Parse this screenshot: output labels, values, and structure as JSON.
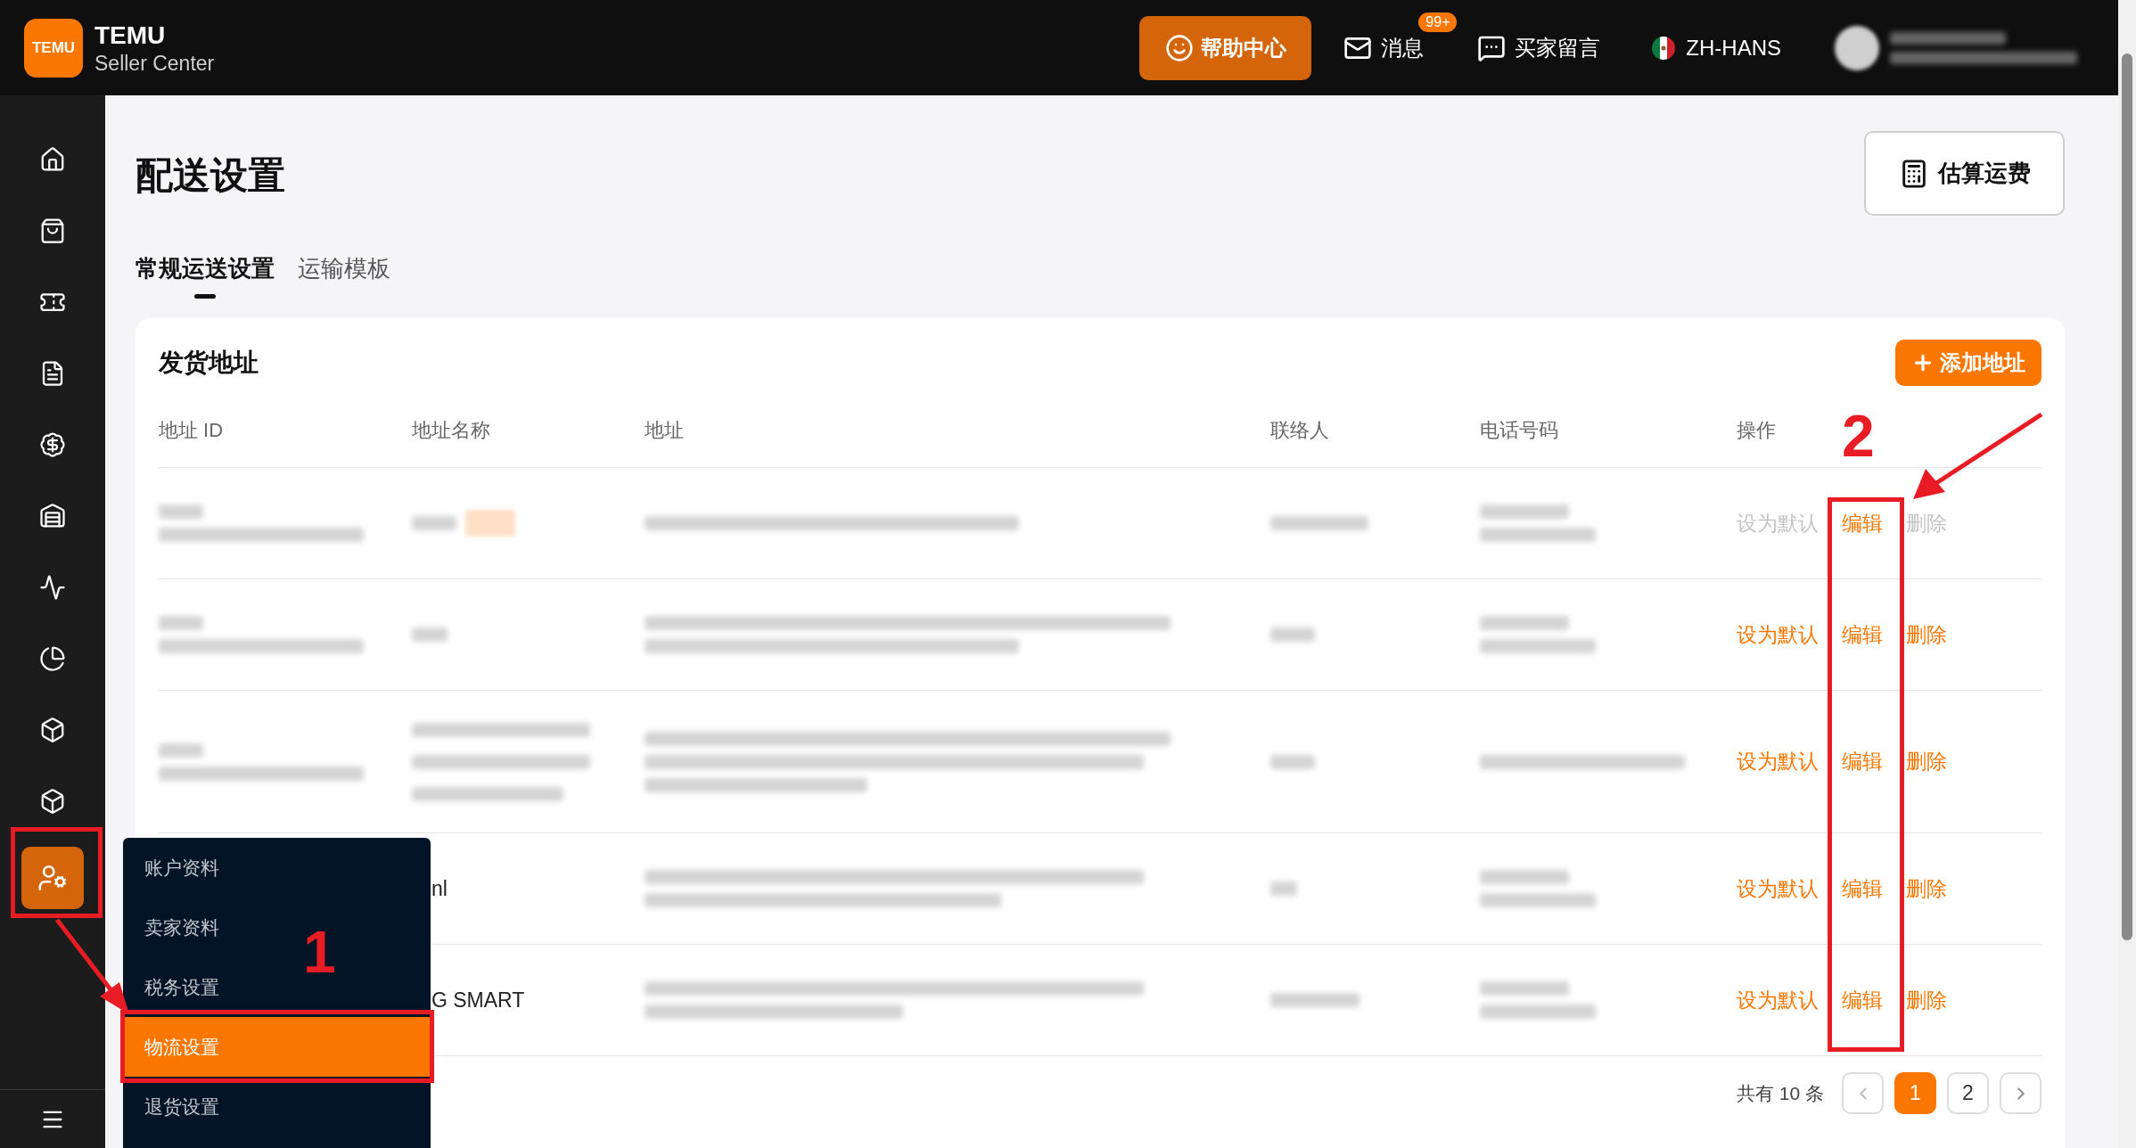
{
  "header": {
    "logo_mark": "TEMU",
    "brand": "TEMU",
    "subtitle": "Seller Center",
    "help_button": "帮助中心",
    "messages": {
      "label": "消息",
      "badge": "99+"
    },
    "buyer_messages": "买家留言",
    "language": "ZH-HANS"
  },
  "sidebar": {
    "items": [
      {
        "selected": false
      },
      {
        "selected": false
      },
      {
        "selected": false
      },
      {
        "selected": false
      },
      {
        "selected": false
      },
      {
        "selected": false
      },
      {
        "selected": false
      },
      {
        "selected": false
      },
      {
        "selected": false
      },
      {
        "selected": false
      },
      {
        "selected": true
      }
    ]
  },
  "menu": {
    "items": [
      {
        "label": "账户资料",
        "selected": false
      },
      {
        "label": "卖家资料",
        "selected": false
      },
      {
        "label": "税务设置",
        "selected": false
      },
      {
        "label": "物流设置",
        "selected": true
      },
      {
        "label": "退货设置",
        "selected": false
      }
    ]
  },
  "page": {
    "title": "配送设置",
    "estimate_button": "估算运费",
    "tabs": [
      {
        "label": "常规运送设置",
        "selected": true
      },
      {
        "label": "运输模板",
        "selected": false
      }
    ]
  },
  "card": {
    "title": "发货地址",
    "add_button": "添加地址",
    "columns": [
      "地址 ID",
      "地址名称",
      "地址",
      "联络人",
      "电话号码",
      "操作"
    ],
    "rows": [
      {
        "name_fragment": "",
        "actions": [
          {
            "label": "设为默认",
            "disabled": true
          },
          {
            "label": "编辑",
            "disabled": false
          },
          {
            "label": "删除",
            "disabled": true
          }
        ]
      },
      {
        "name_fragment": "",
        "actions": [
          {
            "label": "设为默认",
            "disabled": false
          },
          {
            "label": "编辑",
            "disabled": false
          },
          {
            "label": "删除",
            "disabled": false
          }
        ]
      },
      {
        "name_fragment": "",
        "actions": [
          {
            "label": "设为默认",
            "disabled": false
          },
          {
            "label": "编辑",
            "disabled": false
          },
          {
            "label": "删除",
            "disabled": false
          }
        ]
      },
      {
        "name_fragment": "nl",
        "actions": [
          {
            "label": "设为默认",
            "disabled": false
          },
          {
            "label": "编辑",
            "disabled": false
          },
          {
            "label": "删除",
            "disabled": false
          }
        ]
      },
      {
        "name_fragment": "G SMART",
        "actions": [
          {
            "label": "设为默认",
            "disabled": false
          },
          {
            "label": "编辑",
            "disabled": false
          },
          {
            "label": "删除",
            "disabled": false
          }
        ]
      }
    ],
    "pagination": {
      "total": "共有 10 条",
      "pages": [
        {
          "label": "1",
          "selected": true
        },
        {
          "label": "2",
          "selected": false
        }
      ]
    }
  },
  "annotations": {
    "step_1": "1",
    "step_2": "2"
  }
}
